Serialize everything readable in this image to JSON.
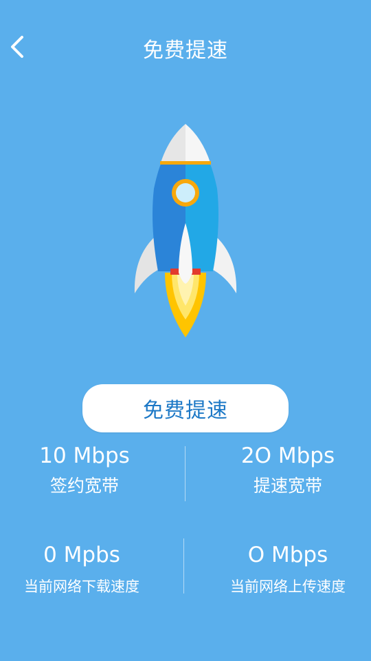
{
  "header": {
    "title": "免费提速",
    "back_icon": "chevron-left-icon"
  },
  "rocket": {
    "icon": "rocket-icon"
  },
  "boost_button": {
    "label": "免费提速"
  },
  "stats": {
    "contract_bandwidth": {
      "value": "10 Mbps",
      "label": "签约宽带"
    },
    "boost_bandwidth": {
      "value": "2O Mbps",
      "label": "提速宽带"
    },
    "download_speed": {
      "value": "0 Mpbs",
      "label": "当前网络下载速度"
    },
    "upload_speed": {
      "value": "O Mbps",
      "label": "当前网络上传速度"
    }
  },
  "colors": {
    "background": "#5aafec",
    "button_text": "#1c78c6",
    "button_bg": "#ffffff"
  }
}
